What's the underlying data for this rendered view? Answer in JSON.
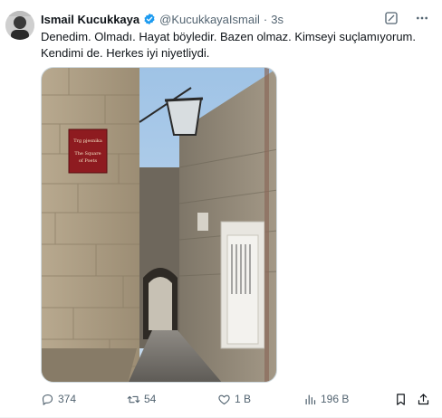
{
  "author": {
    "display_name": "Ismail Kucukkaya",
    "handle": "@KucukkayaIsmail",
    "separator": "·",
    "time": "3s",
    "verified": true,
    "verified_color": "#1d9bf0"
  },
  "tweet": {
    "text": "Denedim. Olmadı. Hayat böyledir. Bazen olmaz. Kimseyi suçlamıyorum.\nKendimi de. Herkes iyi niyetliydi."
  },
  "media": {
    "sign_line1": "Trg pjesnika",
    "sign_line2": "The Square",
    "sign_line3": "of Poets"
  },
  "actions": {
    "replies": "374",
    "retweets": "54",
    "likes": "1 B",
    "views": "196 B"
  },
  "icons": {
    "top": [
      "grok-icon",
      "more-icon"
    ],
    "bottom": [
      "reply-icon",
      "retweet-icon",
      "like-icon",
      "views-icon",
      "bookmark-icon",
      "share-icon"
    ]
  },
  "colors": {
    "text": "#0f1419",
    "muted": "#536471",
    "accent": "#1d9bf0",
    "border": "#cfd9de"
  }
}
